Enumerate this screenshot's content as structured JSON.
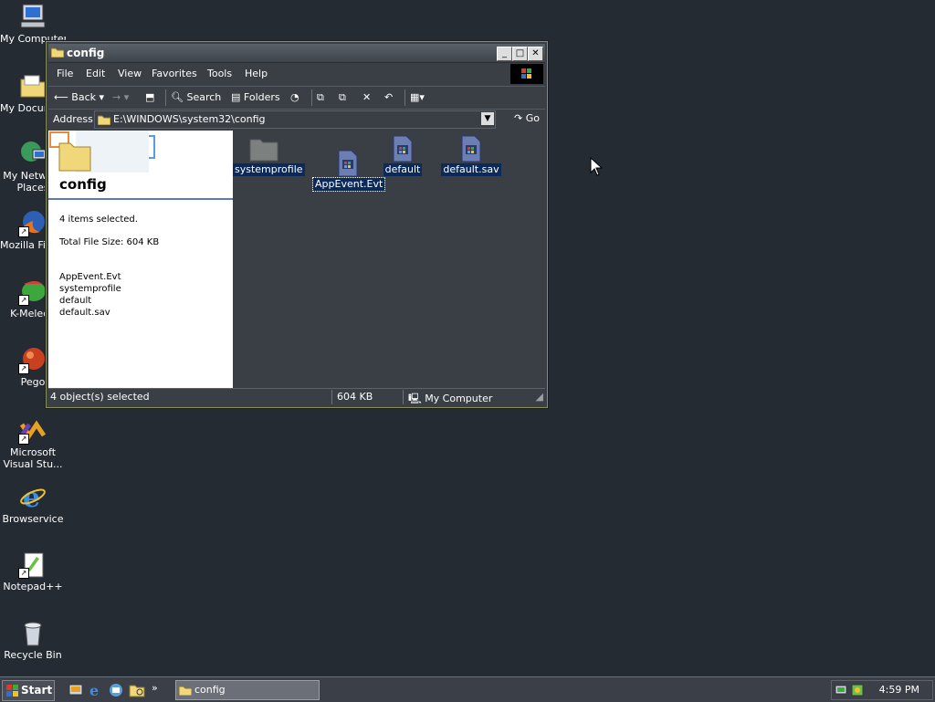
{
  "desktop": {
    "icons": [
      {
        "label": "My Computer",
        "icon": "my-computer-icon"
      },
      {
        "label": "My Documents",
        "icon": "folder-icon"
      },
      {
        "label": "My Network Places",
        "icon": "network-icon"
      },
      {
        "label": "Mozilla Firefox",
        "icon": "firefox-icon"
      },
      {
        "label": "K-Meleon",
        "icon": "k-meleon-icon"
      },
      {
        "label": "Pego",
        "icon": "pego-icon"
      },
      {
        "label": "Microsoft Visual Stu...",
        "icon": "visual-studio-icon"
      },
      {
        "label": "Browservice",
        "icon": "ie-icon"
      },
      {
        "label": "Notepad++",
        "icon": "notepad-icon"
      },
      {
        "label": "Recycle Bin",
        "icon": "recycle-bin-icon"
      }
    ]
  },
  "window": {
    "title": "config",
    "menu": [
      "File",
      "Edit",
      "View",
      "Favorites",
      "Tools",
      "Help"
    ],
    "toolbar": {
      "back": "Back",
      "search": "Search",
      "folders": "Folders"
    },
    "address": {
      "label": "Address",
      "value": "E:\\WINDOWS\\system32\\config",
      "go": "Go"
    },
    "taskpane": {
      "title": "config",
      "selected": "4 items selected.",
      "size": "Total File Size: 604 KB",
      "files": [
        "AppEvent.Evt",
        "systemprofile",
        "default",
        "default.sav"
      ]
    },
    "files": [
      {
        "name": "systemprofile",
        "type": "folder"
      },
      {
        "name": "AppEvent.Evt",
        "type": "file"
      },
      {
        "name": "default",
        "type": "file"
      },
      {
        "name": "default.sav",
        "type": "file"
      }
    ],
    "status": {
      "objects": "4 object(s) selected",
      "size": "604 KB",
      "location": "My Computer"
    }
  },
  "taskbar": {
    "start": "Start",
    "task": "config",
    "clock": "4:59 PM"
  }
}
